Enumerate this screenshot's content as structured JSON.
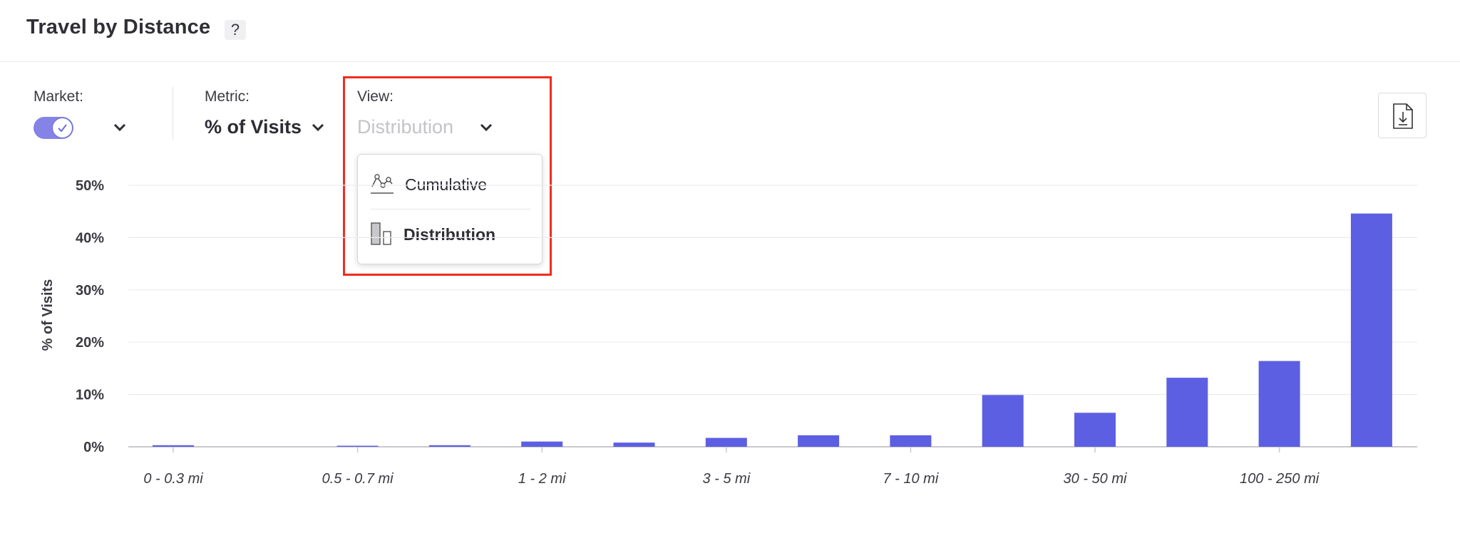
{
  "header": {
    "title": "Travel by Distance",
    "help": "?"
  },
  "controls": {
    "market": {
      "label": "Market:",
      "toggle_on": true
    },
    "metric": {
      "label": "Metric:",
      "value": "% of Visits"
    },
    "view": {
      "label": "View:",
      "value": "Distribution"
    }
  },
  "view_menu": {
    "items": [
      {
        "label": "Cumulative",
        "icon": "line-chart-icon",
        "selected": false
      },
      {
        "label": "Distribution",
        "icon": "bar-chart-icon",
        "selected": true
      }
    ]
  },
  "export": {
    "icon": "download-file-icon"
  },
  "colors": {
    "bar": "#5d5fe3",
    "accent": "#8583e6",
    "highlight": "#ee2d1f"
  },
  "chart_data": {
    "type": "bar",
    "ylabel": "% of Visits",
    "y_ticks": [
      "0%",
      "10%",
      "20%",
      "30%",
      "40%",
      "50%"
    ],
    "ylim": [
      0,
      50
    ],
    "x_tick_labels": [
      "0 - 0.3 mi",
      "0.5 - 0.7 mi",
      "1 - 2 mi",
      "3 - 5 mi",
      "7 - 10 mi",
      "30 - 50 mi",
      "100 - 250 mi"
    ],
    "x_tick_label_positions": [
      0,
      2,
      4,
      6,
      8,
      10,
      12
    ],
    "values": [
      0.3,
      0,
      0.2,
      0.3,
      1.0,
      0.8,
      1.7,
      2.2,
      2.2,
      9.9,
      6.5,
      13.2,
      16.4,
      44.6
    ]
  }
}
